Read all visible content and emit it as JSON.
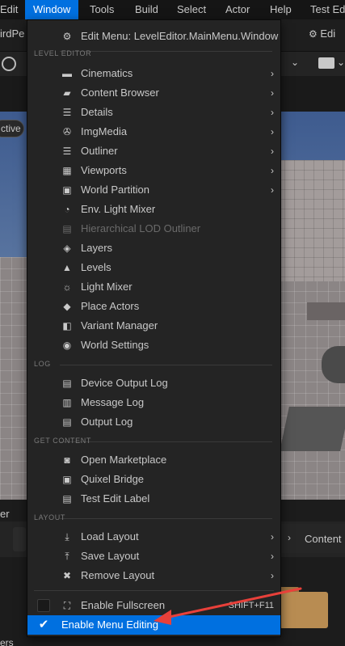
{
  "menubar": {
    "items": [
      "Edit",
      "Window",
      "Tools",
      "Build",
      "Select",
      "Actor",
      "Help",
      "Test Ed"
    ]
  },
  "toolbar": {
    "left_fragment": "irdPe",
    "right_fragment": "Edi"
  },
  "viewport": {
    "mode_pill": "ctive"
  },
  "bottom": {
    "left_fragment": "er",
    "left_fragment2": "ers",
    "content_label": "Content"
  },
  "menu": {
    "edit_menu_label": "Edit Menu: LevelEditor.MainMenu.Window",
    "sections": {
      "level_editor": "LEVEL EDITOR",
      "log": "LOG",
      "get_content": "GET CONTENT",
      "layout": "LAYOUT"
    },
    "level_editor_items": [
      {
        "label": "Cinematics",
        "icon": "clapperboard-icon",
        "submenu": true
      },
      {
        "label": "Content Browser",
        "icon": "folder-search-icon",
        "submenu": true
      },
      {
        "label": "Details",
        "icon": "details-list-icon",
        "submenu": true
      },
      {
        "label": "ImgMedia",
        "icon": "film-reel-icon",
        "submenu": true
      },
      {
        "label": "Outliner",
        "icon": "outliner-icon",
        "submenu": true
      },
      {
        "label": "Viewports",
        "icon": "viewports-grid-icon",
        "submenu": true
      },
      {
        "label": "World Partition",
        "icon": "world-partition-icon",
        "submenu": true
      },
      {
        "label": "Env. Light Mixer",
        "icon": "light-mixer-icon",
        "submenu": false
      },
      {
        "label": "Hierarchical LOD Outliner",
        "icon": "hlod-icon",
        "submenu": false,
        "disabled": true
      },
      {
        "label": "Layers",
        "icon": "layers-icon",
        "submenu": false
      },
      {
        "label": "Levels",
        "icon": "levels-icon",
        "submenu": false
      },
      {
        "label": "Light Mixer",
        "icon": "sun-icon",
        "submenu": false
      },
      {
        "label": "Place Actors",
        "icon": "place-actors-icon",
        "submenu": false
      },
      {
        "label": "Variant Manager",
        "icon": "variant-manager-icon",
        "submenu": false
      },
      {
        "label": "World Settings",
        "icon": "world-settings-icon",
        "submenu": false
      }
    ],
    "log_items": [
      {
        "label": "Device Output Log",
        "icon": "device-log-icon"
      },
      {
        "label": "Message Log",
        "icon": "message-log-icon"
      },
      {
        "label": "Output Log",
        "icon": "output-log-icon"
      }
    ],
    "get_content_items": [
      {
        "label": "Open Marketplace",
        "icon": "marketplace-icon"
      },
      {
        "label": "Quixel Bridge",
        "icon": "bridge-icon"
      },
      {
        "label": "Test Edit Label",
        "icon": "test-icon"
      }
    ],
    "layout_items": [
      {
        "label": "Load Layout",
        "icon": "load-layout-icon",
        "submenu": true
      },
      {
        "label": "Save Layout",
        "icon": "save-layout-icon",
        "submenu": true
      },
      {
        "label": "Remove Layout",
        "icon": "remove-layout-icon",
        "submenu": true
      }
    ],
    "fullscreen": {
      "label": "Enable Fullscreen",
      "shortcut": "SHIFT+F11",
      "checked": false
    },
    "menu_editing": {
      "label": "Enable Menu Editing",
      "checked": true
    }
  },
  "colors": {
    "menu_bg": "#242424",
    "highlight": "#0070e0",
    "annotation_arrow": "#e8403a"
  }
}
